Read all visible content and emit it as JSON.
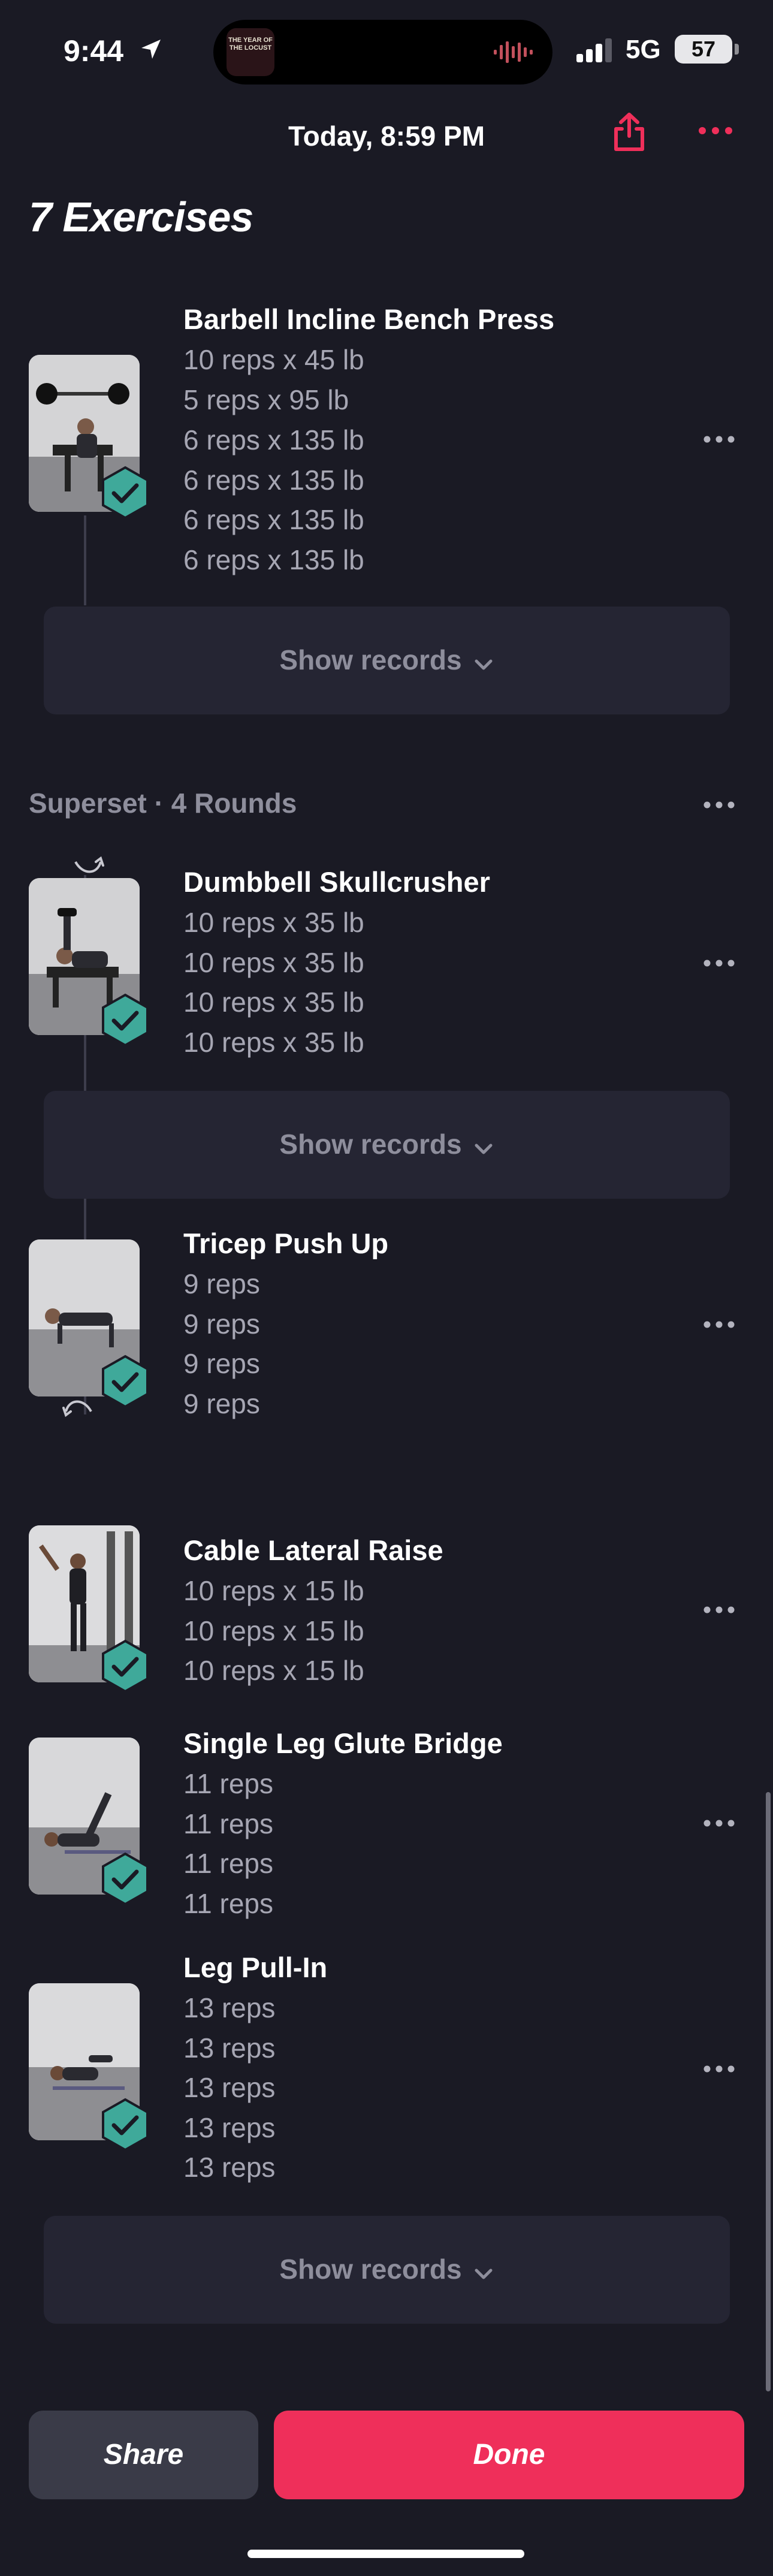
{
  "status_bar": {
    "time": "9:44",
    "network": "5G",
    "battery": "57",
    "now_playing_art": "THE YEAR OF THE LOCUST"
  },
  "header": {
    "title": "Today, 8:59 PM"
  },
  "page": {
    "heading": "7 Exercises"
  },
  "exercises": [
    {
      "name": "Barbell Incline Bench Press",
      "sets": [
        "10 reps x 45 lb",
        "5 reps x 95 lb",
        "6 reps x 135 lb",
        "6 reps x 135 lb",
        "6 reps x 135 lb",
        "6 reps x 135 lb"
      ]
    },
    {
      "name": "Dumbbell Skullcrusher",
      "sets": [
        "10 reps x 35 lb",
        "10 reps x 35 lb",
        "10 reps x 35 lb",
        "10 reps x 35 lb"
      ]
    },
    {
      "name": "Tricep Push Up",
      "sets": [
        "9 reps",
        "9 reps",
        "9 reps",
        "9 reps"
      ]
    },
    {
      "name": "Cable Lateral Raise",
      "sets": [
        "10 reps x 15 lb",
        "10 reps x 15 lb",
        "10 reps x 15 lb"
      ]
    },
    {
      "name": "Single Leg Glute Bridge",
      "sets": [
        "11 reps",
        "11 reps",
        "11 reps",
        "11 reps"
      ]
    },
    {
      "name": "Leg Pull-In",
      "sets": [
        "13 reps",
        "13 reps",
        "13 reps",
        "13 reps",
        "13 reps"
      ]
    }
  ],
  "superset": {
    "label": "Superset · 4 Rounds"
  },
  "records": {
    "label": "Show records"
  },
  "footer": {
    "share_label": "Share",
    "done_label": "Done"
  },
  "colors": {
    "background": "#1a1a24",
    "accent": "#ef2f5a",
    "check": "#3fa99a",
    "card": "#252533"
  }
}
